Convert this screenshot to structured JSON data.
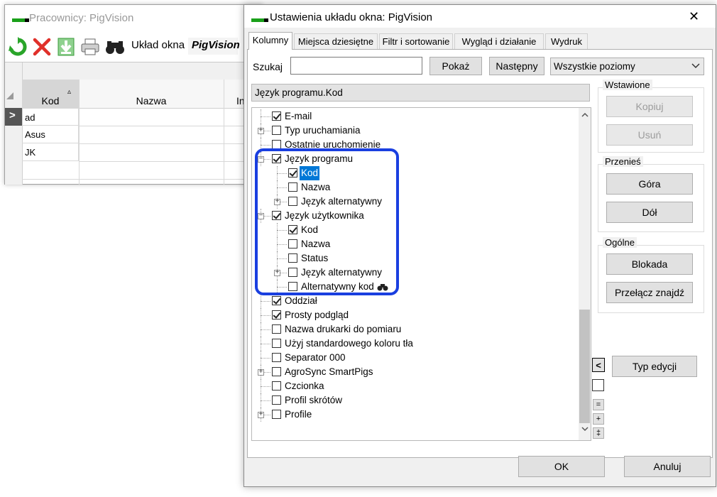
{
  "bg_window": {
    "title": "Pracownicy: PigVision",
    "toolbar": {
      "layout_label": "Układ okna",
      "brand": "PigVision"
    },
    "grid": {
      "columns": [
        "Kod",
        "Nazwa",
        "In"
      ],
      "rows": [
        {
          "kod": "ad"
        },
        {
          "kod": "Asus"
        },
        {
          "kod": "JK"
        }
      ],
      "current_row_marker": ">"
    }
  },
  "dialog": {
    "title": "Ustawienia układu okna: PigVision",
    "close_glyph": "✕",
    "tabs": [
      "Kolumny",
      "Miejsca dziesiętne",
      "Filtr i sortowanie",
      "Wygląd i działanie",
      "Wydruk"
    ],
    "active_tab": 0,
    "search": {
      "label": "Szukaj",
      "value": "",
      "show_label": "Pokaż",
      "next_label": "Następny",
      "level_value": "Wszystkie poziomy"
    },
    "path": "Język programu.Kod",
    "tree": [
      {
        "label": "E-mail",
        "checked": true
      },
      {
        "label": "Typ uruchamiania",
        "checked": false,
        "expander": "+"
      },
      {
        "label": "Ostatnie uruchomienie",
        "checked": false
      },
      {
        "label": "Język programu",
        "checked": true,
        "expander": "−"
      },
      {
        "label": "Kod",
        "checked": true,
        "selected": true
      },
      {
        "label": "Nazwa",
        "checked": false
      },
      {
        "label": "Język alternatywny",
        "checked": false,
        "expander": "+"
      },
      {
        "label": "Język użytkownika",
        "checked": true,
        "expander": "−"
      },
      {
        "label": "Kod",
        "checked": true
      },
      {
        "label": "Nazwa",
        "checked": false
      },
      {
        "label": "Status",
        "checked": false
      },
      {
        "label": "Język alternatywny",
        "checked": false,
        "expander": "+"
      },
      {
        "label": "Alternatywny kod",
        "checked": false
      },
      {
        "label": "Oddział",
        "checked": true
      },
      {
        "label": "Prosty podgląd",
        "checked": true
      },
      {
        "label": "Nazwa drukarki do pomiaru",
        "checked": false
      },
      {
        "label": "Użyj standardowego koloru tła",
        "checked": false
      },
      {
        "label": "Separator 000",
        "checked": false
      },
      {
        "label": "AgroSync SmartPigs",
        "checked": false,
        "expander": "+"
      },
      {
        "label": "Czcionka",
        "checked": false
      },
      {
        "label": "Profil skrótów",
        "checked": false
      },
      {
        "label": "Profile",
        "checked": false,
        "expander": "+"
      }
    ],
    "groups": {
      "inserted": {
        "label": "Wstawione",
        "copy": "Kopiuj",
        "remove": "Usuń"
      },
      "move": {
        "label": "Przenieś",
        "up": "Góra",
        "down": "Dół"
      },
      "general": {
        "label": "Ogólne",
        "lock": "Blokada",
        "toggle_find": "Przełącz znajdź"
      }
    },
    "edit_type_label": "Typ edycji",
    "small_buttons": {
      "arrow_left": "<",
      "minus": "=",
      "plus": "+",
      "expand": "‡"
    },
    "footer": {
      "ok": "OK",
      "cancel": "Anuluj"
    },
    "highlight_color": "#1a3fe0",
    "selection_color": "#0078d7"
  }
}
